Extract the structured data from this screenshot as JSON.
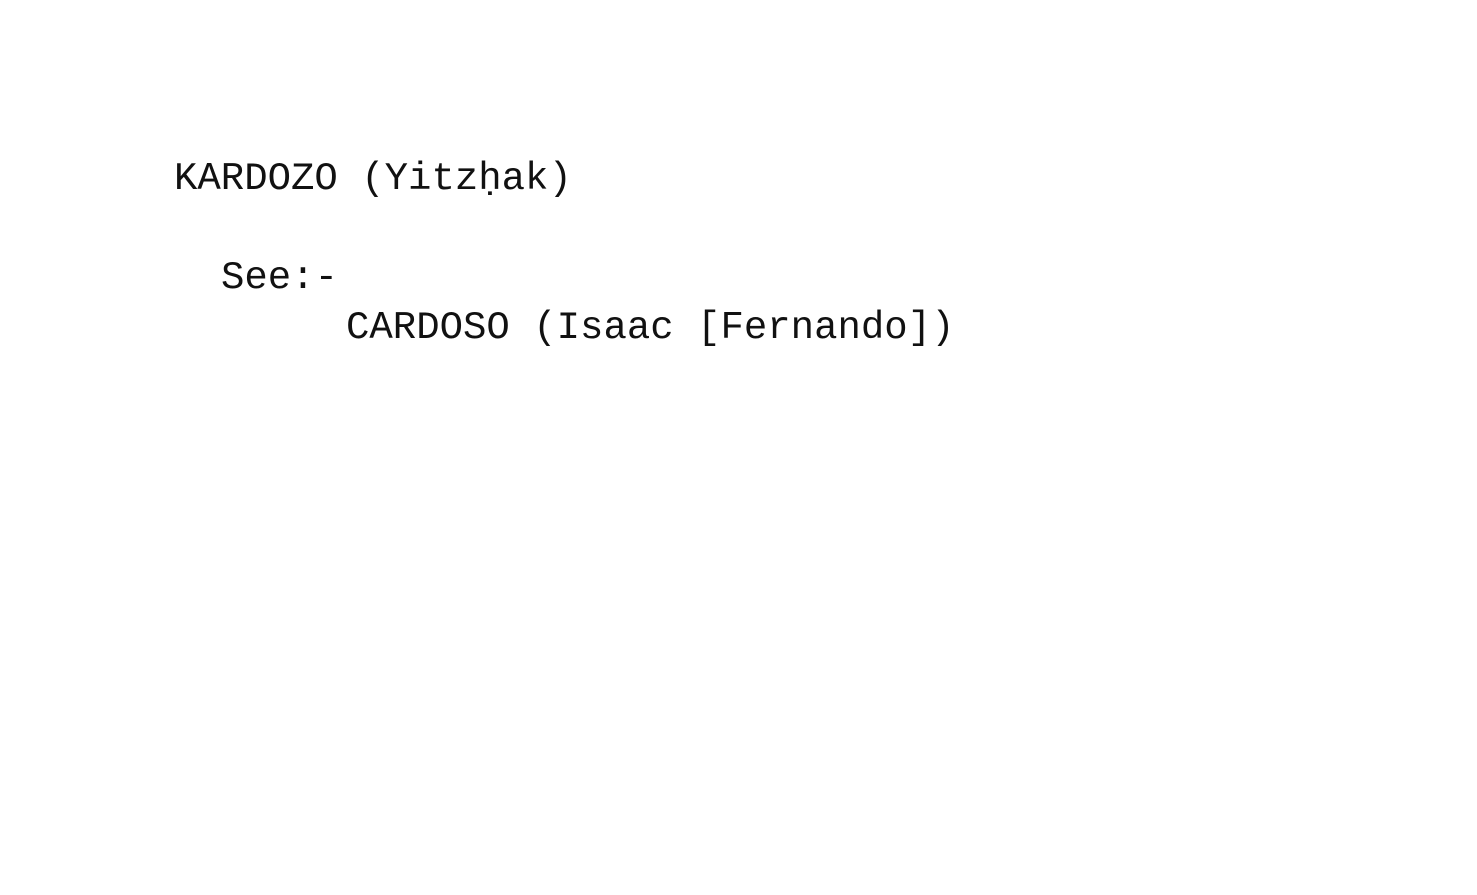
{
  "card": {
    "heading": "KARDOZO (Yitzḥak)",
    "see_label": "See:-",
    "reference": "CARDOSO (Isaac [Fernando])"
  }
}
